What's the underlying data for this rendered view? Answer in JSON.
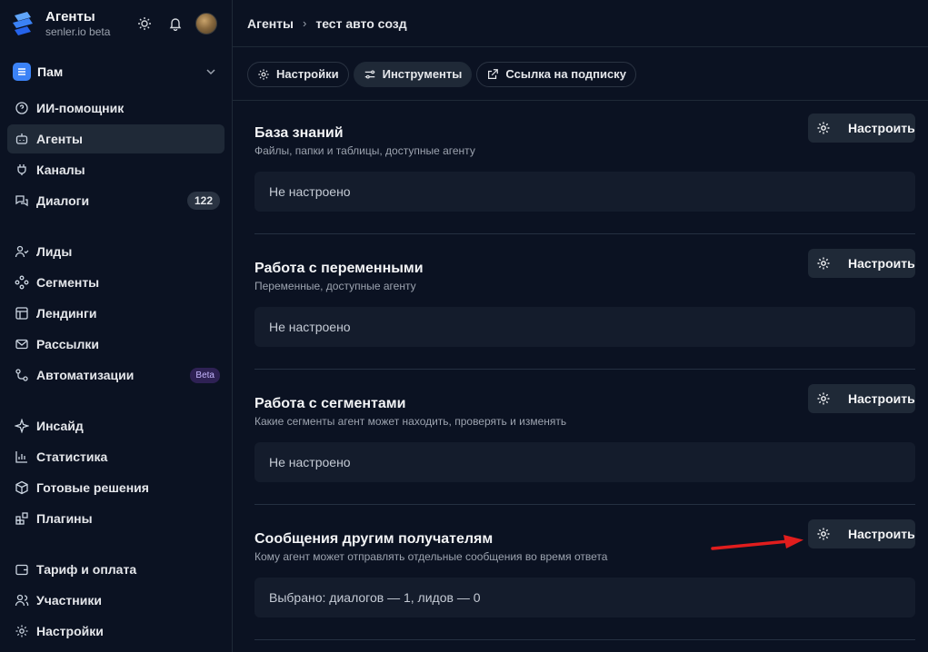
{
  "brand": {
    "title": "Агенты",
    "subtitle": "senler.io beta",
    "logo_icon": "agents-logo-icon"
  },
  "header_icons": [
    "sun-icon",
    "bell-icon",
    "avatar"
  ],
  "project": {
    "name": "Пам"
  },
  "sidebar": {
    "items": [
      {
        "label": "ИИ-помощник",
        "icon": "question-chat-icon"
      },
      {
        "label": "Агенты",
        "icon": "bot-icon",
        "active": true
      },
      {
        "label": "Каналы",
        "icon": "plug-icon"
      },
      {
        "label": "Диалоги",
        "icon": "chats-icon",
        "badge": "122"
      },
      {
        "label": "Лиды",
        "icon": "user-check-icon"
      },
      {
        "label": "Сегменты",
        "icon": "segments-icon"
      },
      {
        "label": "Лендинги",
        "icon": "layout-icon"
      },
      {
        "label": "Рассылки",
        "icon": "mail-icon"
      },
      {
        "label": "Автоматизации",
        "icon": "workflow-icon",
        "badge": "Beta"
      },
      {
        "label": "Инсайд",
        "icon": "sparkle-icon"
      },
      {
        "label": "Статистика",
        "icon": "bar-chart-icon"
      },
      {
        "label": "Готовые решения",
        "icon": "box-icon"
      },
      {
        "label": "Плагины",
        "icon": "blocks-icon"
      },
      {
        "label": "Тариф и оплата",
        "icon": "wallet-icon"
      },
      {
        "label": "Участники",
        "icon": "users-icon"
      },
      {
        "label": "Настройки",
        "icon": "gear-icon"
      }
    ]
  },
  "breadcrumb": {
    "root": "Агенты",
    "current": "тест авто созд"
  },
  "tabs": [
    {
      "label": "Настройки",
      "icon": "gear-icon"
    },
    {
      "label": "Инструменты",
      "icon": "sliders-icon",
      "active": true
    },
    {
      "label": "Ссылка на подписку",
      "icon": "external-link-icon"
    }
  ],
  "sections": [
    {
      "title": "База знаний",
      "description": "Файлы, папки и таблицы, доступные агенту",
      "button": "Настроить",
      "status": "Не настроено"
    },
    {
      "title": "Работа с переменными",
      "description": "Переменные, доступные агенту",
      "button": "Настроить",
      "status": "Не настроено"
    },
    {
      "title": "Работа с сегментами",
      "description": "Какие сегменты агент может находить, проверять и изменять",
      "button": "Настроить",
      "status": "Не настроено"
    },
    {
      "title": "Сообщения другим получателям",
      "description": "Кому агент может отправлять отдельные сообщения во время ответа",
      "button": "Настроить",
      "status": "Выбрано: диалогов — 1, лидов — 0"
    }
  ],
  "colors": {
    "background": "#0b1222",
    "panel": "#141c2c",
    "button": "#1f2937",
    "accent": "#3b82f6",
    "arrow": "#e11d1d"
  }
}
